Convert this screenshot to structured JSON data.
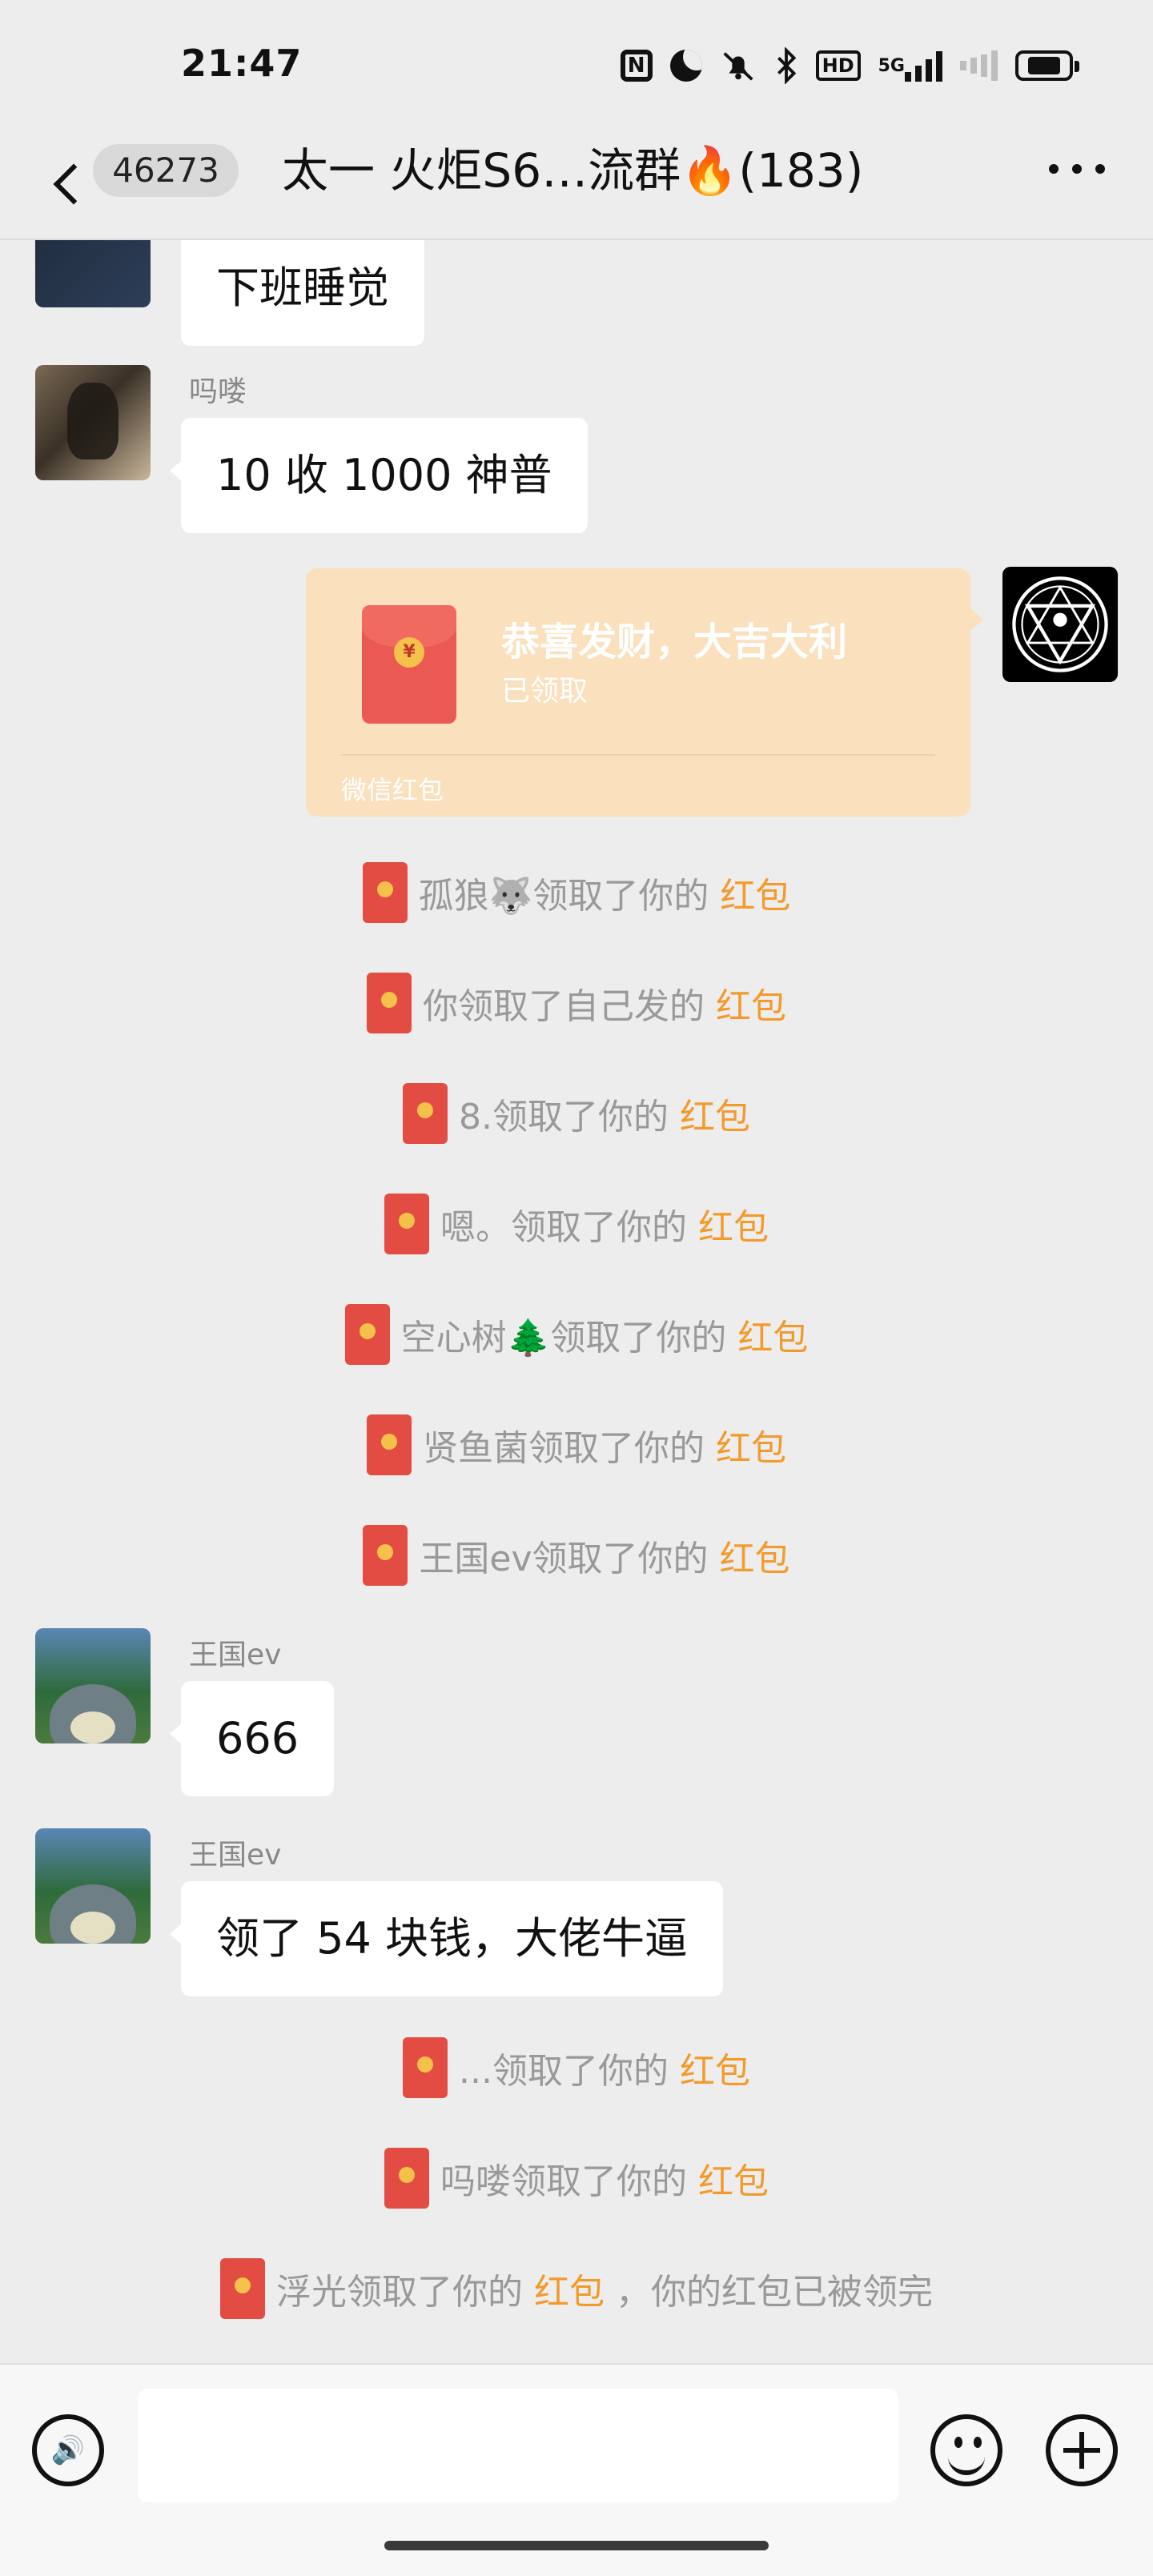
{
  "status_bar": {
    "time": "21:47",
    "nfc_label": "N",
    "hd_label": "HD",
    "network_label": "5G"
  },
  "header": {
    "unread_count": "46273",
    "title": "太一  火炬S6…流群🔥(183)"
  },
  "messages": {
    "m1": {
      "text": "下班睡觉"
    },
    "m2": {
      "sender": "吗喽",
      "text": "10 收 1000 神普"
    },
    "red_packet": {
      "coin_glyph": "¥",
      "title": "恭喜发财，大吉大利",
      "status": "已领取",
      "footer": "微信红包"
    },
    "system": [
      {
        "prefix": "孤狼🐺领取了你的",
        "link": "红包"
      },
      {
        "prefix": "你领取了自己发的",
        "link": "红包"
      },
      {
        "prefix": "8.领取了你的",
        "link": "红包"
      },
      {
        "prefix": "嗯。领取了你的",
        "link": "红包"
      },
      {
        "prefix": "空心树🌲领取了你的",
        "link": "红包"
      },
      {
        "prefix": "贤鱼菌领取了你的",
        "link": "红包"
      },
      {
        "prefix": "王国ev领取了你的",
        "link": "红包"
      }
    ],
    "m3": {
      "sender": "王国ev",
      "text": "666"
    },
    "m4": {
      "sender": "王国ev",
      "text": "领了 54 块钱，大佬牛逼"
    },
    "system2": [
      {
        "prefix": "...领取了你的",
        "link": "红包"
      },
      {
        "prefix": "吗喽领取了你的",
        "link": "红包"
      },
      {
        "prefix": "浮光领取了你的",
        "link": "红包",
        "suffix": "，你的红包已被领完"
      }
    ]
  },
  "input_bar": {
    "voice_glyph": "🔊",
    "text_value": ""
  },
  "colors": {
    "background": "#ededed",
    "bubble": "#ffffff",
    "red_packet": "#fae0bc",
    "link_orange": "#f39a2b"
  }
}
